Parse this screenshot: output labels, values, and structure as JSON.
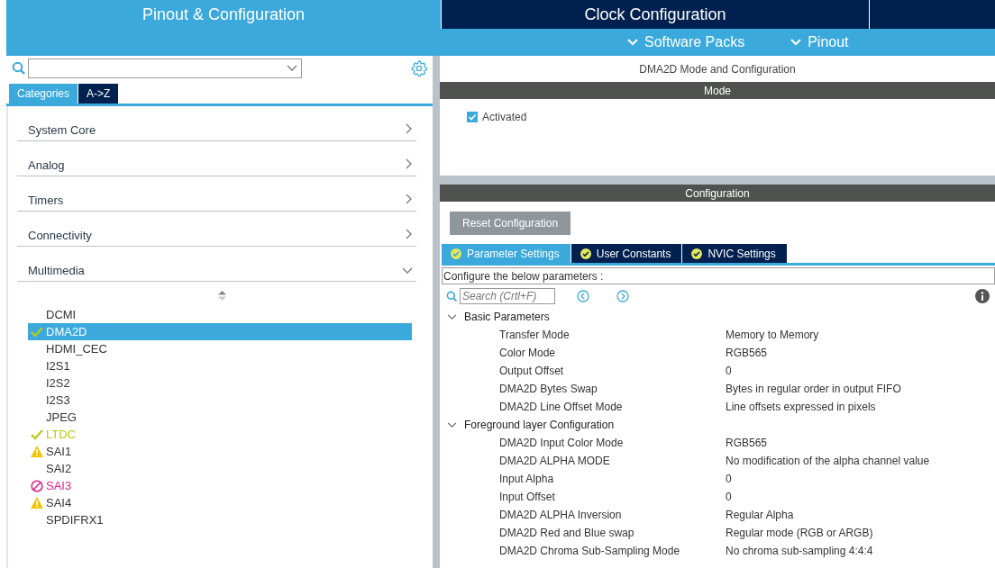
{
  "top_tabs": [
    {
      "label": "Pinout & Configuration",
      "selected": true
    },
    {
      "label": "Clock Configuration",
      "selected": false
    }
  ],
  "menus": [
    {
      "label": "Software Packs"
    },
    {
      "label": "Pinout"
    }
  ],
  "sidebar": {
    "tabs": [
      {
        "label": "Categories",
        "selected": true
      },
      {
        "label": "A->Z",
        "selected": false
      }
    ],
    "categories": [
      {
        "label": "System Core",
        "expanded": false
      },
      {
        "label": "Analog",
        "expanded": false
      },
      {
        "label": "Timers",
        "expanded": false
      },
      {
        "label": "Connectivity",
        "expanded": false
      },
      {
        "label": "Multimedia",
        "expanded": true,
        "children": [
          {
            "label": "DCMI",
            "configured": false,
            "warning": false,
            "conflict": false,
            "selected": false
          },
          {
            "label": "DMA2D",
            "configured": true,
            "warning": false,
            "conflict": false,
            "selected": true
          },
          {
            "label": "HDMI_CEC",
            "configured": false,
            "warning": false,
            "conflict": false,
            "selected": false
          },
          {
            "label": "I2S1",
            "configured": false,
            "warning": false,
            "conflict": false,
            "selected": false
          },
          {
            "label": "I2S2",
            "configured": false,
            "warning": false,
            "conflict": false,
            "selected": false
          },
          {
            "label": "I2S3",
            "configured": false,
            "warning": false,
            "conflict": false,
            "selected": false
          },
          {
            "label": "JPEG",
            "configured": false,
            "warning": false,
            "conflict": false,
            "selected": false
          },
          {
            "label": "LTDC",
            "configured": true,
            "warning": false,
            "conflict": false,
            "selected": false
          },
          {
            "label": "SAI1",
            "configured": false,
            "warning": true,
            "conflict": false,
            "selected": false
          },
          {
            "label": "SAI2",
            "configured": false,
            "warning": false,
            "conflict": false,
            "selected": false
          },
          {
            "label": "SAI3",
            "configured": false,
            "warning": false,
            "conflict": true,
            "selected": false
          },
          {
            "label": "SAI4",
            "configured": false,
            "warning": true,
            "conflict": false,
            "selected": false
          },
          {
            "label": "SPDIFRX1",
            "configured": false,
            "warning": false,
            "conflict": false,
            "selected": false
          }
        ]
      }
    ]
  },
  "panel": {
    "title": "DMA2D Mode and Configuration",
    "mode": {
      "header": "Mode",
      "options": [
        {
          "label": "Activated",
          "checked": true
        }
      ]
    },
    "configuration": {
      "header": "Configuration",
      "reset_button": "Reset Configuration",
      "tabs": [
        {
          "label": "Parameter Settings",
          "selected": true
        },
        {
          "label": "User Constants",
          "selected": false
        },
        {
          "label": "NVIC Settings",
          "selected": false
        }
      ],
      "hint": "Configure the below parameters :",
      "search": {
        "placeholder": "Search (Crtl+F)"
      },
      "groups": [
        {
          "label": "Basic Parameters",
          "expanded": true,
          "params": [
            {
              "name": "Transfer Mode",
              "value": "Memory to Memory"
            },
            {
              "name": "Color Mode",
              "value": "RGB565"
            },
            {
              "name": "Output Offset",
              "value": "0"
            },
            {
              "name": "DMA2D Bytes Swap",
              "value": "Bytes in regular order in output FIFO"
            },
            {
              "name": "DMA2D Line Offset Mode",
              "value": "Line offsets expressed in pixels"
            }
          ]
        },
        {
          "label": "Foreground layer Configuration",
          "expanded": true,
          "params": [
            {
              "name": "DMA2D Input Color Mode",
              "value": "RGB565"
            },
            {
              "name": "DMA2D ALPHA MODE",
              "value": "No modification of the alpha channel value"
            },
            {
              "name": "Input Alpha",
              "value": "0"
            },
            {
              "name": "Input Offset",
              "value": "0"
            },
            {
              "name": "DMA2D ALPHA Inversion",
              "value": "Regular Alpha"
            },
            {
              "name": "DMA2D Red and Blue swap",
              "value": "Regular mode (RGB or ARGB)"
            },
            {
              "name": "DMA2D Chroma Sub-Sampling Mode",
              "value": "No chroma sub-sampling 4:4:4"
            }
          ]
        }
      ]
    }
  }
}
